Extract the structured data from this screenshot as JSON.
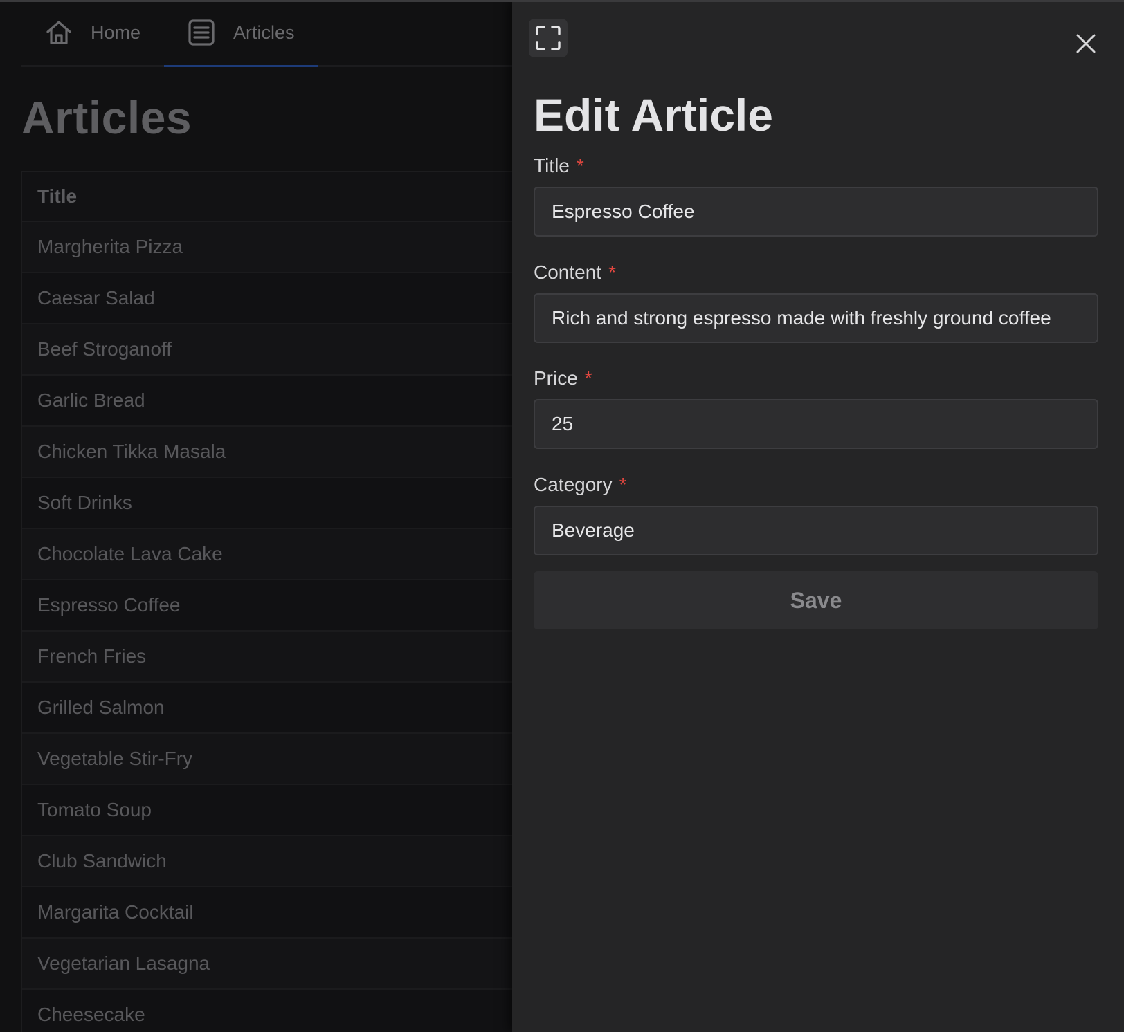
{
  "nav": {
    "tabs": [
      {
        "label": "Home",
        "icon": "home-icon",
        "active": false
      },
      {
        "label": "Articles",
        "icon": "article-list-icon",
        "active": true
      }
    ]
  },
  "list": {
    "page_title": "Articles",
    "column_header": "Title",
    "rows": [
      "Margherita Pizza",
      "Caesar Salad",
      "Beef Stroganoff",
      "Garlic Bread",
      "Chicken Tikka Masala",
      "Soft Drinks",
      "Chocolate Lava Cake",
      "Espresso Coffee",
      "French Fries",
      "Grilled Salmon",
      "Vegetable Stir-Fry",
      "Tomato Soup",
      "Club Sandwich",
      "Margarita Cocktail",
      "Vegetarian Lasagna",
      "Cheesecake"
    ]
  },
  "drawer": {
    "title": "Edit Article",
    "required_marker": "*",
    "fields": {
      "title": {
        "label": "Title",
        "value": "Espresso Coffee"
      },
      "content": {
        "label": "Content",
        "value": "Rich and strong espresso made with freshly ground coffee"
      },
      "price": {
        "label": "Price",
        "value": "25"
      },
      "category": {
        "label": "Category",
        "value": "Beverage"
      }
    },
    "save_label": "Save"
  },
  "colors": {
    "accent_tab_underline": "#1d3b78",
    "required": "#e0473f",
    "drawer_bg": "#252526",
    "page_bg": "#111112"
  }
}
